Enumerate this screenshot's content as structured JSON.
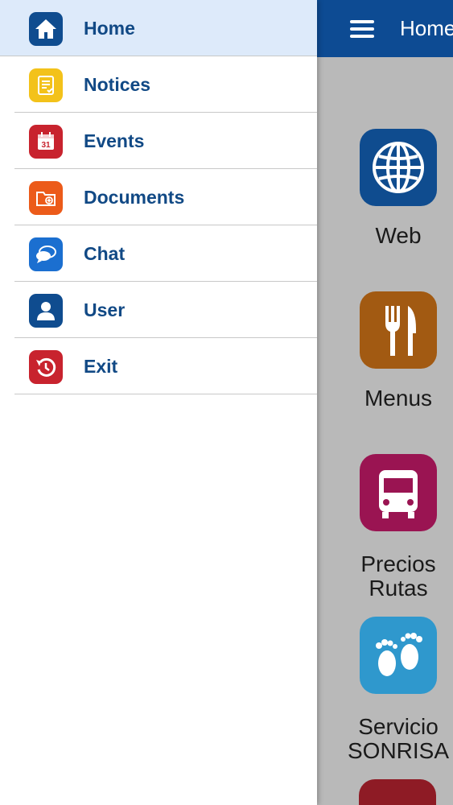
{
  "topbar": {
    "title": "Home",
    "menu_icon": "hamburger-icon"
  },
  "drawer": {
    "items": [
      {
        "label": "Home",
        "icon": "home-icon",
        "color": "#0f4c8f",
        "active": true
      },
      {
        "label": "Notices",
        "icon": "notice-icon",
        "color": "#f3c21a",
        "active": false
      },
      {
        "label": "Events",
        "icon": "calendar-icon",
        "color": "#c8232e",
        "active": false
      },
      {
        "label": "Documents",
        "icon": "folder-icon",
        "color": "#ec5b1a",
        "active": false
      },
      {
        "label": "Chat",
        "icon": "chat-icon",
        "color": "#1b6fd0",
        "active": false
      },
      {
        "label": "User",
        "icon": "user-icon",
        "color": "#0f4c8f",
        "active": false
      },
      {
        "label": "Exit",
        "icon": "exit-icon",
        "color": "#c8232e",
        "active": false
      }
    ],
    "events_icon_day": "31"
  },
  "tiles": [
    {
      "label": "Web",
      "icon": "globe-icon",
      "color": "#0f4c8f"
    },
    {
      "label": "Menus",
      "icon": "cutlery-icon",
      "color": "#a25a12"
    },
    {
      "label_line1": "Precios",
      "label_line2": "Rutas",
      "icon": "bus-icon",
      "color": "#9a1452"
    },
    {
      "label_line1": "Servicio",
      "label_line2": "SONRISA",
      "icon": "baby-feet-icon",
      "color": "#2f98cd"
    }
  ],
  "colors": {
    "topbar": "#0d4b93",
    "drawer_active_bg": "#ddeafa",
    "label_text": "#114985",
    "overlay": "#b9b9b9"
  }
}
